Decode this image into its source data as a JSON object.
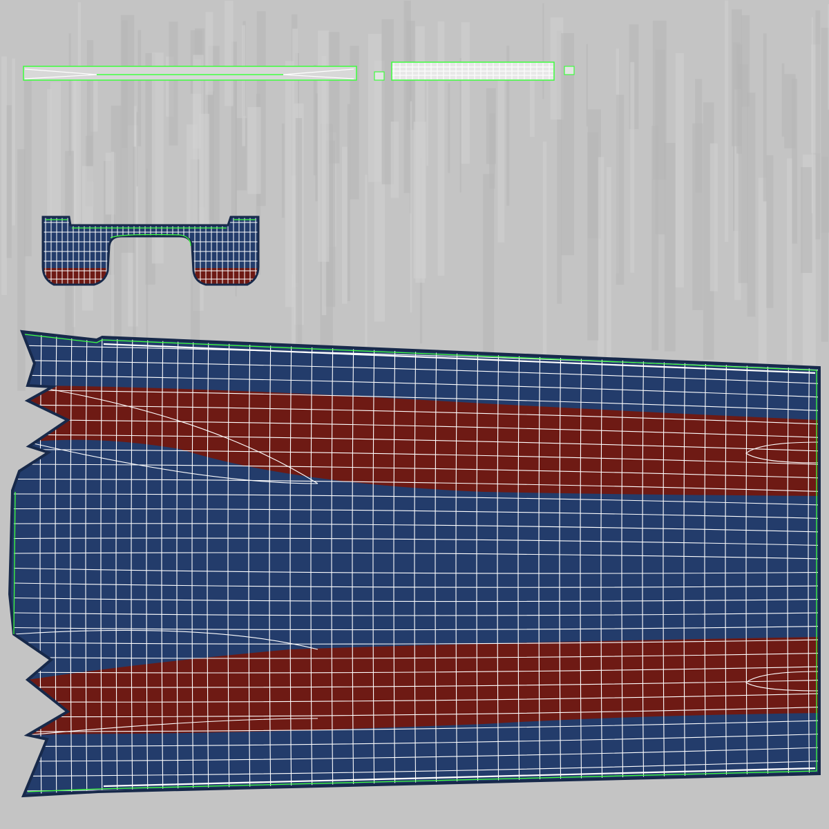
{
  "colors": {
    "background": "#c4c4c4",
    "streak_light": "#d2d2d2",
    "streak_dark": "#b6b6b6",
    "navy": "#233c6b",
    "navy_edge": "#17294a",
    "maroon": "#6e1a14",
    "wire": "#ffffff",
    "seam": "#3dff3d"
  },
  "uv_islands": [
    "waistband-strip",
    "small-square-a",
    "grid-strip",
    "small-square-b",
    "waist-yoke",
    "trouser-panel"
  ]
}
